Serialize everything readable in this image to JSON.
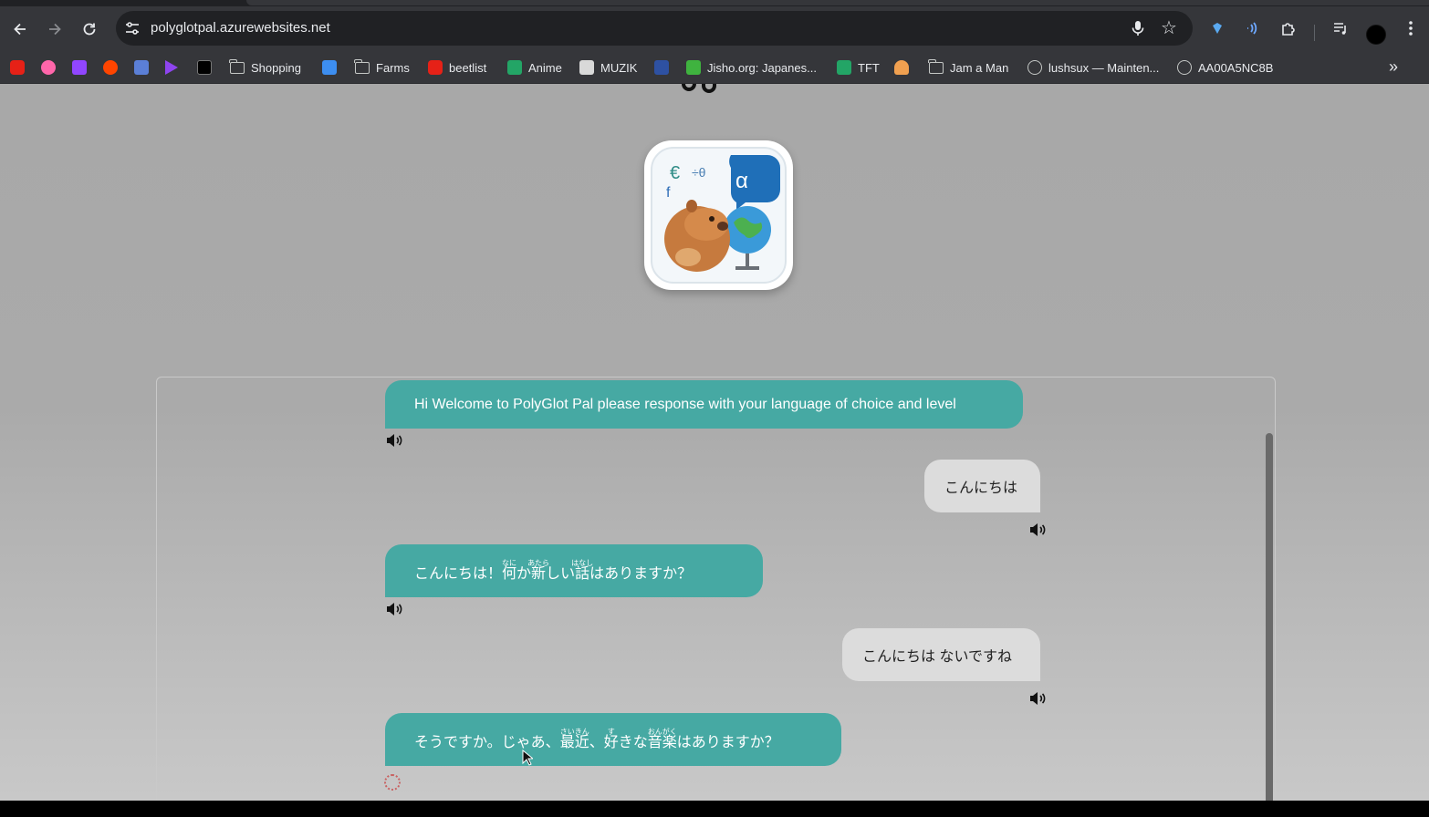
{
  "browser": {
    "url": "polyglotpal.azurewebsites.net",
    "bookmarks": [
      {
        "label": "",
        "icon": "youtube-icon"
      },
      {
        "label": "",
        "icon": "osu-icon"
      },
      {
        "label": "",
        "icon": "twitch-icon"
      },
      {
        "label": "",
        "icon": "reddit-icon"
      },
      {
        "label": "",
        "icon": "bookmark-app-icon"
      },
      {
        "label": "",
        "icon": "play-icon"
      },
      {
        "label": "",
        "icon": "monkeytype-icon"
      },
      {
        "label": "Shopping",
        "icon": "folder-icon"
      },
      {
        "label": "",
        "icon": "blue-app-icon"
      },
      {
        "label": "Farms",
        "icon": "folder-icon"
      },
      {
        "label": "beetlist",
        "icon": "youtube-icon"
      },
      {
        "label": "Anime",
        "icon": "sheets-icon"
      },
      {
        "label": "MUZIK",
        "icon": "music-icon"
      },
      {
        "label": "",
        "icon": "mal-icon"
      },
      {
        "label": "Jisho.org: Japanes...",
        "icon": "jisho-icon"
      },
      {
        "label": "TFT",
        "icon": "sheets-icon"
      },
      {
        "label": "",
        "icon": "food-icon"
      },
      {
        "label": "Jam a Man",
        "icon": "folder-icon"
      },
      {
        "label": "lushsux — Mainten...",
        "icon": "globe-icon"
      },
      {
        "label": "AA00A5NC8B",
        "icon": "globe-icon"
      }
    ]
  },
  "chat": {
    "messages": [
      {
        "role": "bot",
        "text": "Hi Welcome to PolyGlot Pal please response with your language of choice and level"
      },
      {
        "role": "user",
        "text": "こんにちは"
      },
      {
        "role": "bot",
        "parts": [
          "こんにちは！",
          "何",
          "か",
          "新",
          "しい",
          "話",
          "はありますか？"
        ],
        "ruby": [
          "なに",
          "あたら",
          "はなし"
        ]
      },
      {
        "role": "user",
        "text": "こんにちは ないですね"
      },
      {
        "role": "bot",
        "parts": [
          "そうですか。じゃあ、",
          "最近",
          "、",
          "好",
          "きな",
          "音楽",
          "はありますか？"
        ],
        "ruby": [
          "さいきん",
          "す",
          "おんがく"
        ]
      }
    ]
  },
  "colors": {
    "bot_bubble": "#46a9a3",
    "user_bubble": "#dcdcdc",
    "page_background": "#aaaaaa"
  }
}
